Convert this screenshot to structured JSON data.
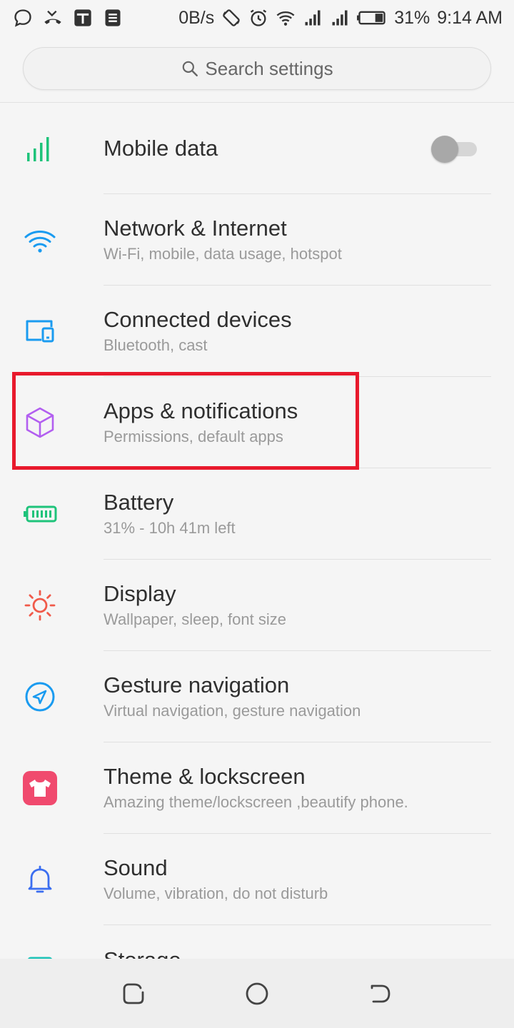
{
  "status_bar": {
    "network_speed": "0B/s",
    "battery_percent": "31%",
    "time": "9:14 AM",
    "left_icons": [
      "message-bubble-icon",
      "missed-call-icon",
      "news-app-icon",
      "document-app-icon"
    ],
    "right_icons": [
      "rotation-lock-icon",
      "alarm-icon",
      "wifi-icon",
      "signal-icon",
      "signal-icon",
      "battery-icon"
    ]
  },
  "search": {
    "placeholder": "Search settings",
    "icon": "search-icon"
  },
  "settings": [
    {
      "title": "Mobile data",
      "subtitle": "",
      "icon": "signal-bars-icon",
      "color": "#1ec37a",
      "toggle": false
    },
    {
      "title": "Network & Internet",
      "subtitle": "Wi-Fi, mobile, data usage, hotspot",
      "icon": "wifi-icon",
      "color": "#1a9bf0"
    },
    {
      "title": "Connected devices",
      "subtitle": "Bluetooth, cast",
      "icon": "devices-icon",
      "color": "#1a9bf0"
    },
    {
      "title": "Apps & notifications",
      "subtitle": "Permissions, default apps",
      "icon": "cube-icon",
      "color": "#b25ef0"
    },
    {
      "title": "Battery",
      "subtitle": "31% - 10h 41m left",
      "icon": "battery-icon",
      "color": "#1ec37a"
    },
    {
      "title": "Display",
      "subtitle": "Wallpaper, sleep, font size",
      "icon": "sun-icon",
      "color": "#f05a4a"
    },
    {
      "title": "Gesture navigation",
      "subtitle": "Virtual navigation, gesture navigation",
      "icon": "navigation-arrow-icon",
      "color": "#1a9bf0"
    },
    {
      "title": "Theme & lockscreen",
      "subtitle": "Amazing theme/lockscreen ,beautify phone.",
      "icon": "shirt-icon",
      "color": "#f04a6e"
    },
    {
      "title": "Sound",
      "subtitle": "Volume, vibration, do not disturb",
      "icon": "bell-icon",
      "color": "#3b6ef0"
    },
    {
      "title": "Storage",
      "subtitle": "",
      "icon": "storage-icon",
      "color": "#1ec3b8"
    }
  ],
  "highlight_color": "#e8192c",
  "nav_bar": {
    "buttons": [
      "recents-button",
      "home-button",
      "back-button"
    ]
  }
}
